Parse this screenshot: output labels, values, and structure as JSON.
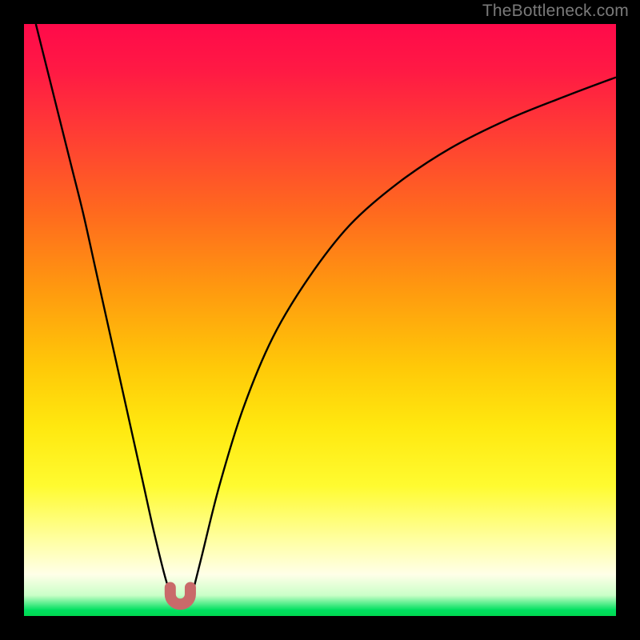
{
  "attribution": "TheBottleneck.com",
  "colors": {
    "frame": "#000000",
    "curve": "#000000",
    "marker": "#c96a6a",
    "gradient_top": "#ff0a4a",
    "gradient_mid": "#ffe80f",
    "gradient_bottom": "#00d850"
  },
  "chart_data": {
    "type": "line",
    "title": "",
    "xlabel": "",
    "ylabel": "",
    "xlim": [
      0,
      100
    ],
    "ylim": [
      0,
      100
    ],
    "grid": false,
    "legend": false,
    "annotations": [],
    "series": [
      {
        "name": "left-branch",
        "x": [
          2,
          4,
          6,
          8,
          10,
          12,
          14,
          16,
          18,
          20,
          22,
          24,
          25.5
        ],
        "values": [
          100,
          92,
          84,
          76,
          68,
          59,
          50,
          41,
          32,
          23,
          14,
          6,
          2
        ]
      },
      {
        "name": "right-branch",
        "x": [
          28,
          30,
          33,
          37,
          42,
          48,
          55,
          63,
          72,
          82,
          92,
          100
        ],
        "values": [
          2,
          10,
          22,
          35,
          47,
          57,
          66,
          73,
          79,
          84,
          88,
          91
        ]
      }
    ],
    "marker": {
      "shape": "u",
      "x_center": 26.4,
      "x_width": 3.4,
      "y_bottom": 2.0,
      "y_top": 4.8
    }
  }
}
